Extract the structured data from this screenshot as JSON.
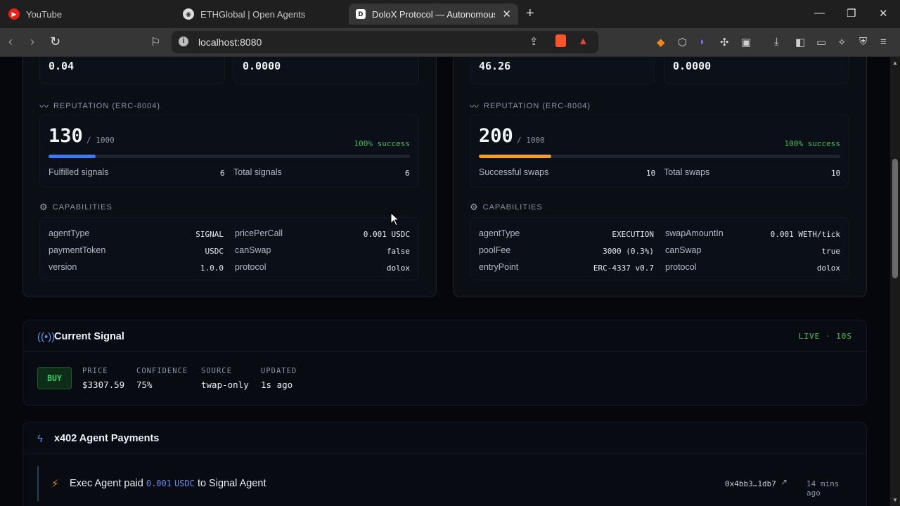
{
  "browser": {
    "tabs": [
      {
        "title": "YouTube",
        "icon": "youtube-icon"
      },
      {
        "title": "ETHGlobal | Open Agents",
        "icon": "ethglobal-icon"
      },
      {
        "title": "DoloX Protocol — Autonomous",
        "icon": "dolox-icon"
      }
    ],
    "url": "localhost:8080"
  },
  "signal_agent": {
    "top_values": [
      "0.04",
      "0.0000"
    ],
    "reputation_label": "REPUTATION (ERC-8004)",
    "score": "130",
    "score_max": "/ 1000",
    "success": "100% success",
    "progress": 0.13,
    "stat1_label": "Fulfilled signals",
    "stat1_value": "6",
    "stat2_label": "Total signals",
    "stat2_value": "6",
    "capabilities_label": "CAPABILITIES",
    "caps": [
      {
        "k": "agentType",
        "v": "SIGNAL"
      },
      {
        "k": "pricePerCall",
        "v": "0.001 USDC"
      },
      {
        "k": "paymentToken",
        "v": "USDC"
      },
      {
        "k": "canSwap",
        "v": "false"
      },
      {
        "k": "version",
        "v": "1.0.0"
      },
      {
        "k": "protocol",
        "v": "dolox"
      }
    ]
  },
  "exec_agent": {
    "top_values": [
      "46.26",
      "0.0000"
    ],
    "reputation_label": "REPUTATION (ERC-8004)",
    "score": "200",
    "score_max": "/ 1000",
    "success": "100% success",
    "progress": 0.2,
    "stat1_label": "Successful swaps",
    "stat1_value": "10",
    "stat2_label": "Total swaps",
    "stat2_value": "10",
    "capabilities_label": "CAPABILITIES",
    "caps": [
      {
        "k": "agentType",
        "v": "EXECUTION"
      },
      {
        "k": "swapAmountIn",
        "v": "0.001 WETH/tick"
      },
      {
        "k": "poolFee",
        "v": "3000 (0.3%)"
      },
      {
        "k": "canSwap",
        "v": "true"
      },
      {
        "k": "entryPoint",
        "v": "ERC-4337 v0.7"
      },
      {
        "k": "protocol",
        "v": "dolox"
      }
    ]
  },
  "current_signal": {
    "title": "Current Signal",
    "live": "LIVE · 10S",
    "action": "BUY",
    "price_label": "PRICE",
    "price": "$3307.59",
    "confidence_label": "CONFIDENCE",
    "confidence": "75%",
    "source_label": "SOURCE",
    "source": "twap-only",
    "updated_label": "UPDATED",
    "updated": "1s ago"
  },
  "payments": {
    "title": "x402 Agent Payments",
    "row": {
      "prefix": "Exec Agent paid",
      "amount": "0.001",
      "token": "USDC",
      "suffix": "to Signal Agent",
      "hash": "0x4bb3…1db7",
      "time": "14 mins ago"
    }
  },
  "colors": {
    "signal_bar": "#3a7bf0",
    "exec_bar": "#f0a21e",
    "success": "#3fbf5e",
    "accent": "#5d8fe8"
  }
}
